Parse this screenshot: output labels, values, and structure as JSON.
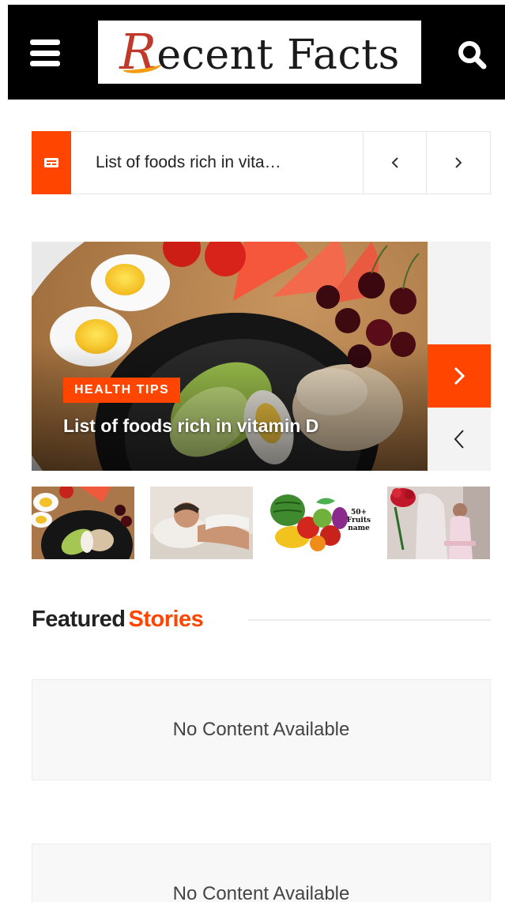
{
  "header": {
    "logo_first_letter": "R",
    "logo_rest": "ecent Facts",
    "menu_icon": "hamburger-menu-icon",
    "search_icon": "search-icon",
    "background_color": "#000000"
  },
  "ticker": {
    "icon": "newspaper-icon",
    "text": "List of foods rich in vita…",
    "prev_label": "‹",
    "next_label": "›"
  },
  "slider": {
    "category": "HEALTH TIPS",
    "title": "List of foods rich in vitamin D",
    "next_icon": "chevron-right-icon",
    "prev_icon": "chevron-left-icon"
  },
  "thumbnails": [
    {
      "name": "food-bowl-thumbnail",
      "label": ""
    },
    {
      "name": "sleeping-man-thumbnail",
      "label": ""
    },
    {
      "name": "fruits-thumbnail",
      "label": "50+ Fruits name"
    },
    {
      "name": "winter-fashion-thumbnail",
      "label": ""
    }
  ],
  "featured": {
    "title_word1": "Featured",
    "title_word2": "Stories"
  },
  "empty_states": [
    {
      "text": "No Content Available"
    },
    {
      "text": "No Content Available"
    }
  ],
  "colors": {
    "accent": "#ff4500",
    "header": "#000000",
    "text": "#222222"
  }
}
